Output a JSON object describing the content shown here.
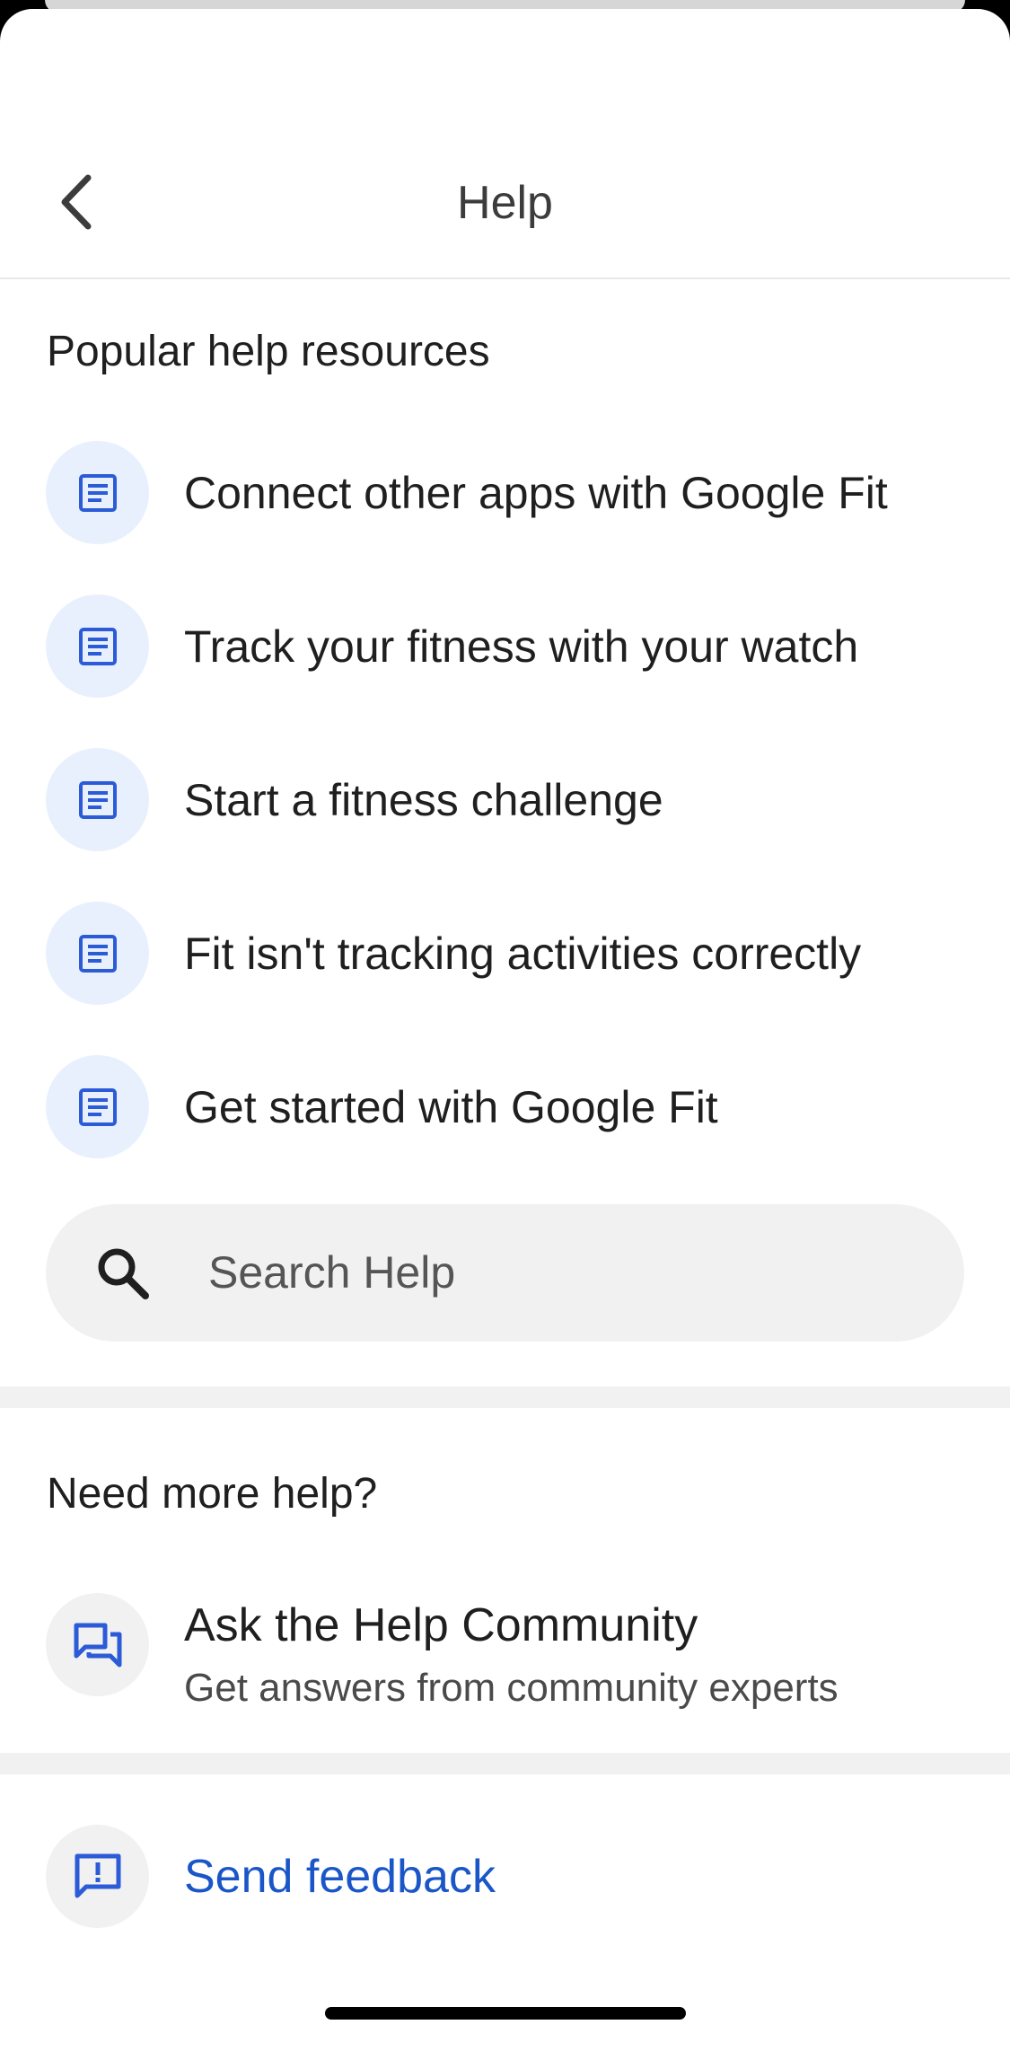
{
  "header": {
    "title": "Help",
    "back_icon": "chevron-left-icon"
  },
  "popular": {
    "heading": "Popular help resources",
    "icon": "article-icon",
    "icon_color": "#2b5bd6",
    "icon_bg": "#e8f0fe",
    "items": [
      {
        "label": "Connect other apps with Google Fit"
      },
      {
        "label": "Track your fitness with your watch"
      },
      {
        "label": "Start a fitness challenge"
      },
      {
        "label": "Fit isn't tracking activities correctly"
      },
      {
        "label": "Get started with Google Fit"
      }
    ]
  },
  "search": {
    "placeholder": "Search Help",
    "icon": "search-icon"
  },
  "more_help": {
    "heading": "Need more help?",
    "community": {
      "title": "Ask the Help Community",
      "subtitle": "Get answers from community experts",
      "icon": "forum-icon"
    }
  },
  "feedback": {
    "label": "Send feedback",
    "icon": "feedback-icon",
    "color": "#1a56c7"
  }
}
